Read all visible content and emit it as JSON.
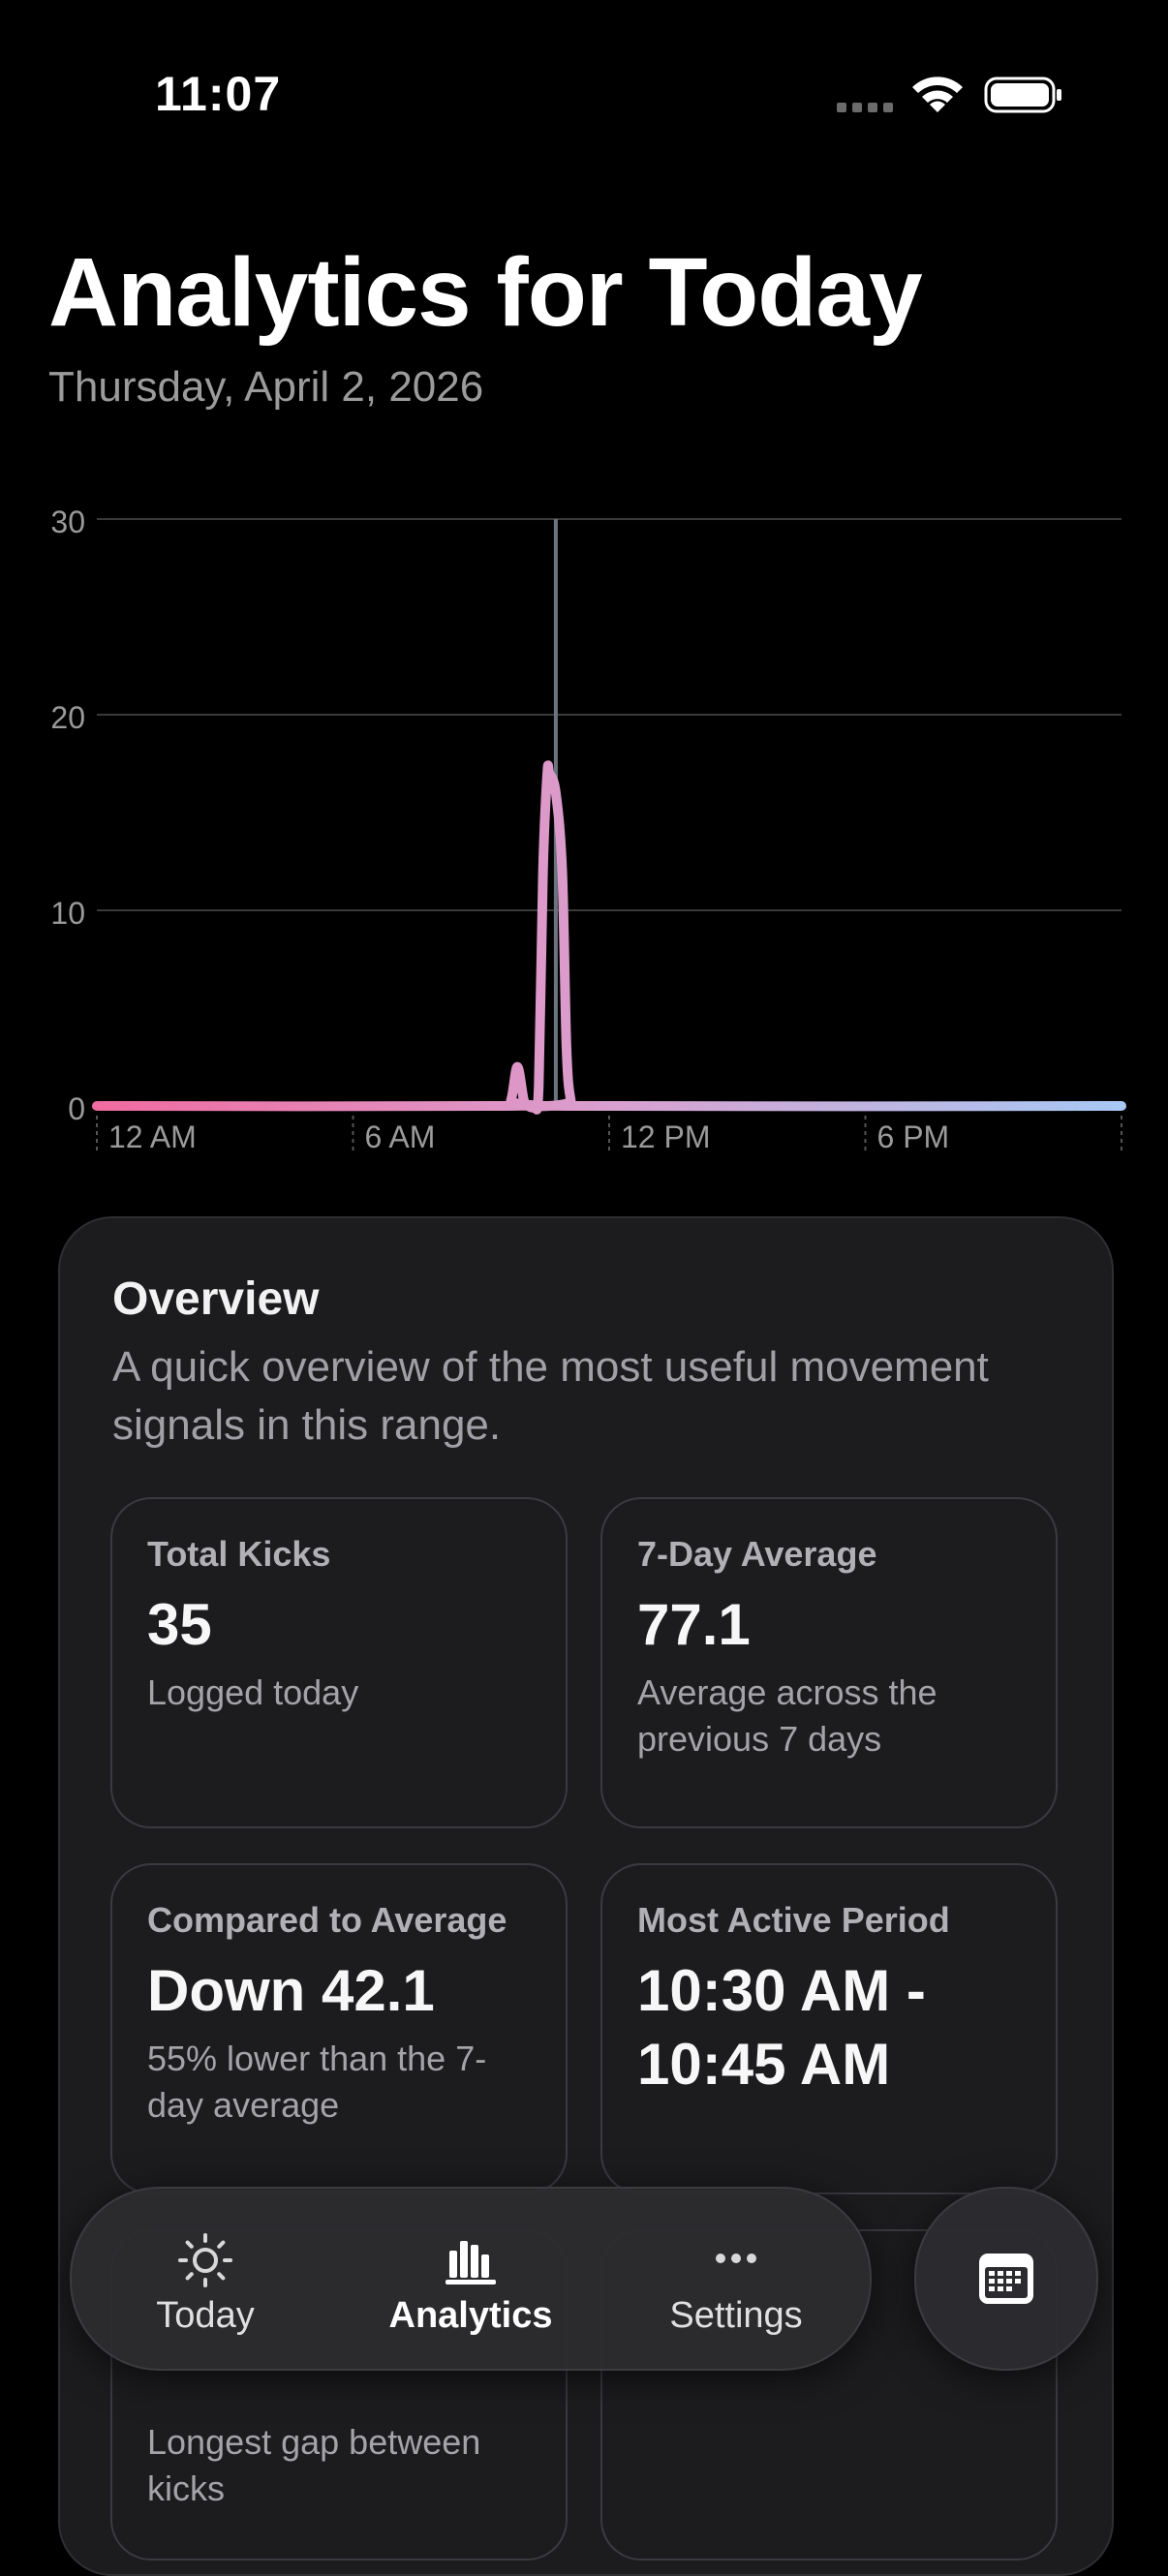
{
  "status": {
    "time": "11:07"
  },
  "header": {
    "title": "Analytics for Today",
    "date": "Thursday, April 2, 2026"
  },
  "chart_data": {
    "type": "line",
    "x_ticks": [
      "12 AM",
      "6 AM",
      "12 PM",
      "6 PM"
    ],
    "y_ticks": [
      "0",
      "10",
      "20",
      "30"
    ],
    "ylim": [
      0,
      30
    ],
    "x_range_hours": [
      0,
      24
    ],
    "grid": true,
    "selected_x_hours": 10.75,
    "series": [
      {
        "x_hours": [
          0,
          9.5,
          9.7,
          9.85,
          10.0,
          10.1,
          10.25,
          10.35,
          10.45,
          10.55,
          10.6,
          10.75,
          10.9,
          11.0,
          11.1,
          11.25,
          24
        ],
        "values": [
          0,
          0,
          0.3,
          2,
          0.3,
          0,
          0,
          1,
          12,
          17,
          17,
          16,
          12,
          3,
          0.3,
          0,
          0
        ],
        "gradient": [
          "#f06ba0",
          "#d9a0cf",
          "#a6c8f3"
        ]
      }
    ]
  },
  "overview": {
    "title": "Overview",
    "description": "A quick overview of the most useful movement signals in this range.",
    "tiles": [
      {
        "label": "Total Kicks",
        "value": "35",
        "sub": "Logged today"
      },
      {
        "label": "7-Day Average",
        "value": "77.1",
        "sub": "Average across the previous 7 days"
      },
      {
        "label": "Compared to Average",
        "value": "Down 42.1",
        "sub": "55% lower than the 7-day average"
      },
      {
        "label": "Most Active Period",
        "value": "10:30 AM - 10:45 AM",
        "sub": ""
      },
      {
        "label": "",
        "value": "",
        "sub": "Longest gap between kicks"
      },
      {
        "label": "",
        "value": "",
        "sub": ""
      }
    ]
  },
  "tabbar": {
    "tabs": [
      {
        "label": "Today",
        "icon": "sun-icon"
      },
      {
        "label": "Analytics",
        "icon": "chart-bars-icon",
        "active": true
      },
      {
        "label": "Settings",
        "icon": "ellipsis-icon"
      }
    ],
    "calendar_icon": "calendar-icon"
  }
}
